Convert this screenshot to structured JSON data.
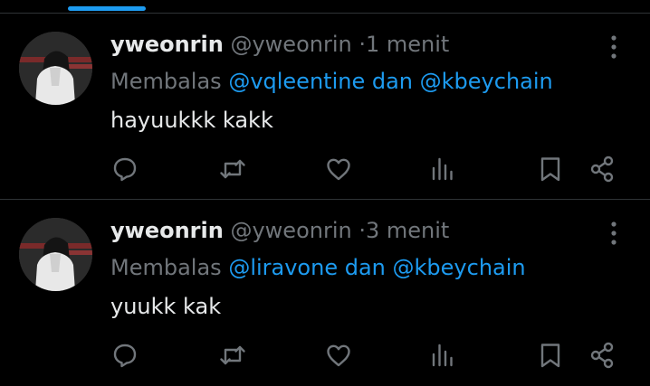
{
  "colors": {
    "background": "#000000",
    "text": "#e7e9ea",
    "muted": "#71767b",
    "accent": "#1d9bf0",
    "divider": "#2f3336"
  },
  "posts": [
    {
      "display_name": "yweonrin",
      "handle": "@yweonrin",
      "separator": "·",
      "time": "1 menit",
      "reply_prefix": "Membalas",
      "mention_1": "@vqleentine",
      "conjunction": "dan",
      "mention_2": "@kbeychain",
      "text": "hayuukkk kakk",
      "icons": [
        "reply-icon",
        "repost-icon",
        "like-icon",
        "views-icon",
        "bookmark-icon",
        "share-icon",
        "more-icon"
      ]
    },
    {
      "display_name": "yweonrin",
      "handle": "@yweonrin",
      "separator": "·",
      "time": "3 menit",
      "reply_prefix": "Membalas",
      "mention_1": "@liravone",
      "conjunction": "dan",
      "mention_2": "@kbeychain",
      "text": "yuukk kak",
      "icons": [
        "reply-icon",
        "repost-icon",
        "like-icon",
        "views-icon",
        "bookmark-icon",
        "share-icon",
        "more-icon"
      ]
    }
  ]
}
